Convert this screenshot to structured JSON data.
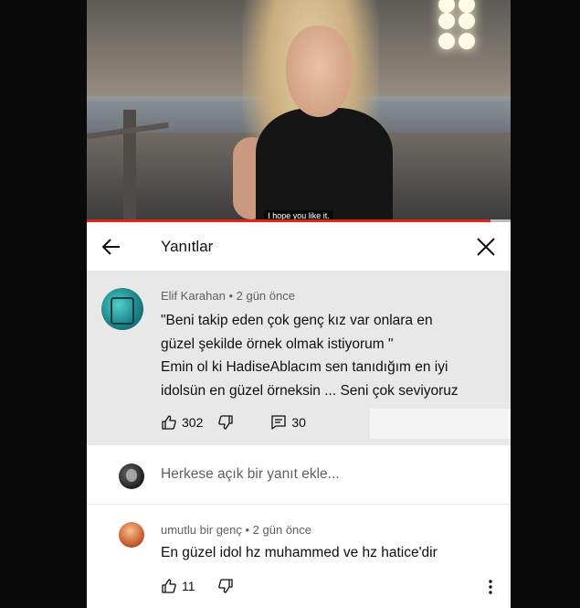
{
  "video": {
    "caption": "I hope you like it."
  },
  "header": {
    "title": "Yanıtlar",
    "back_icon": "arrow-left-icon",
    "close_icon": "close-icon"
  },
  "main_comment": {
    "author": "Elif Karahan",
    "time": "• 2 gün önce",
    "lines": [
      "\"Beni takip eden çok genç kız var onlara en",
      "güzel şekilde örnek olmak istiyorum \"",
      "Emin ol ki HadiseAblacım sen tanıdığım en iyi",
      "idolsün en güzel örneksin ... Seni çok seviyoruz"
    ],
    "likes": "302",
    "replies": "30"
  },
  "add_reply": {
    "placeholder": "Herkese açık bir yanıt ekle..."
  },
  "reply_comment": {
    "author": "umutlu bir genç",
    "time": "• 2 gün önce",
    "text": "En güzel idol hz muhammed ve hz hatice'dir",
    "likes": "11"
  },
  "colors": {
    "progress": "#e62117",
    "highlight_bg": "#e8e8e8",
    "page_bg": "#0a0a0a"
  }
}
